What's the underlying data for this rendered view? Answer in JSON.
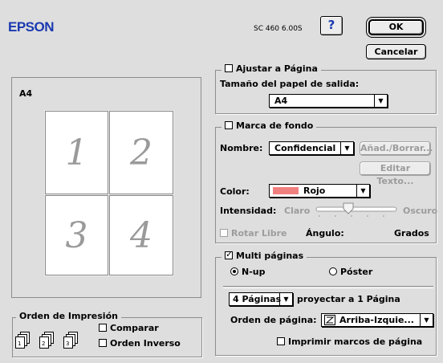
{
  "header": {
    "brand": "EPSON",
    "model": "SC 460 6.00S",
    "help": "?",
    "ok": "OK",
    "cancel": "Cancelar"
  },
  "preview": {
    "paper": "A4",
    "pages": [
      "1",
      "2",
      "3",
      "4"
    ]
  },
  "print_order": {
    "legend": "Orden de Impresión",
    "collate": "Comparar",
    "reverse": "Orden Inverso"
  },
  "fit_page": {
    "legend": "Ajustar a Página",
    "checked": false,
    "output_label": "Tamaño del papel de salida:",
    "output_value": "A4"
  },
  "watermark": {
    "legend": "Marca de fondo",
    "checked": false,
    "name_label": "Nombre:",
    "name_value": "Confidencial",
    "add_delete": "Añad./Borrar...",
    "edit_text": "Editar Texto...",
    "color_label": "Color:",
    "color_value": "Rojo",
    "color_swatch": "#f08080",
    "intensity_label": "Intensidad:",
    "light": "Claro",
    "dark": "Oscuro",
    "free_rotate": "Rotar Libre",
    "angle_label": "Ángulo:",
    "degrees": "Grados"
  },
  "multi_page": {
    "legend": "Multi páginas",
    "checked": true,
    "nup": "N-up",
    "poster": "Póster",
    "pages_value": "4 Páginas",
    "project_text": "proyectar a 1 Página",
    "order_label": "Orden de página:",
    "order_value": "Arriba-Izquie...",
    "print_borders": "Imprimir marcos de página"
  }
}
